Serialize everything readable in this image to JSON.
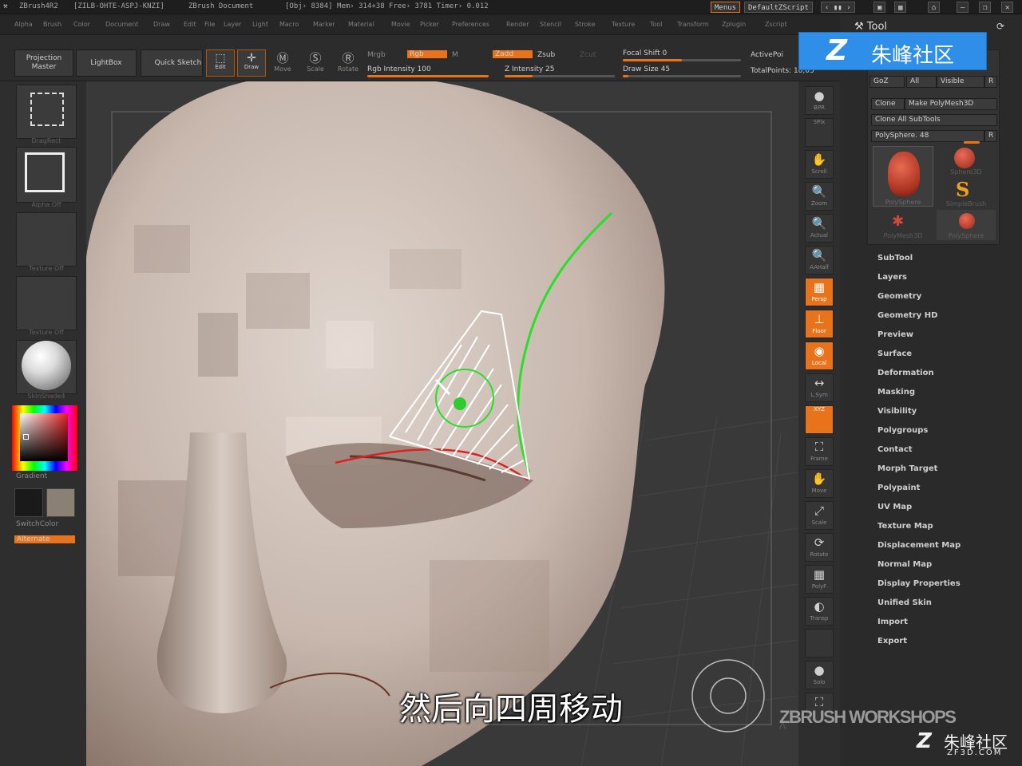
{
  "titlebar": {
    "app": "ZBrush4R2",
    "serial": "[ZILB-OHTE-ASPJ-KNZI]",
    "document": "ZBrush Document",
    "stats": "[Obj› 8384] Mem› 314+38 Free› 3781 Timer› 0.012",
    "menus": "Menus",
    "script": "DefaultZScript"
  },
  "menubar": [
    "Alpha",
    "Brush",
    "Color",
    "Document",
    "Draw",
    "Edit",
    "File",
    "Layer",
    "Light",
    "Macro",
    "Marker",
    "Material",
    "Movie",
    "Picker",
    "Preferences",
    "Render",
    "Stencil",
    "Stroke",
    "Texture",
    "Tool",
    "Transform",
    "Zplugin",
    "Zscript"
  ],
  "toolbar": {
    "projection_master": "Projection Master",
    "lightbox": "LightBox",
    "quick_sketch": "Quick Sketch",
    "edit": "Edit",
    "draw": "Draw",
    "move": "Move",
    "scale": "Scale",
    "rotate": "Rotate",
    "mrgb": "Mrgb",
    "rgb": "Rgb",
    "m": "M",
    "rgb_intensity": "Rgb Intensity 100",
    "zadd": "Zadd",
    "zsub": "Zsub",
    "zcut": "Zcut",
    "z_intensity": "Z Intensity 25",
    "focal_shift": "Focal Shift 0",
    "draw_size": "Draw Size 45",
    "active_points": "ActivePoi",
    "total_points": "TotalPoints: 10,05",
    "rgb_intensity_value": 100,
    "z_intensity_value": 25,
    "focal_shift_value": 0,
    "draw_size_value": 45
  },
  "left_shelf": {
    "stroke_caption": "DragRect",
    "alpha_caption": "Alpha Off",
    "texture_caption": "Texture Off",
    "texture2_caption": "Texture Off",
    "material_caption": "SkinShade4",
    "gradient": "Gradient",
    "switchcolor": "SwitchColor",
    "alternate": "Alternate",
    "main_color": "#1a1a1a",
    "secondary_color": "#8a8074"
  },
  "right_shelf": [
    {
      "name": "bpr",
      "label": "BPR",
      "glyph": "●",
      "on": false
    },
    {
      "name": "spix",
      "label": "SPix",
      "glyph": "",
      "on": false
    },
    {
      "name": "scroll",
      "label": "Scroll",
      "glyph": "✋",
      "on": false
    },
    {
      "name": "zoom",
      "label": "Zoom",
      "glyph": "🔍",
      "on": false
    },
    {
      "name": "actual",
      "label": "Actual",
      "glyph": "🔍",
      "on": false
    },
    {
      "name": "aahalf",
      "label": "AAHalf",
      "glyph": "🔍",
      "on": false
    },
    {
      "name": "persp",
      "label": "Persp",
      "glyph": "▦",
      "on": true
    },
    {
      "name": "floor",
      "label": "Floor",
      "glyph": "⊥",
      "on": true
    },
    {
      "name": "local",
      "label": "Local",
      "glyph": "◉",
      "on": true
    },
    {
      "name": "lsym",
      "label": "L.Sym",
      "glyph": "↔",
      "on": false
    },
    {
      "name": "xyz",
      "label": "XYZ",
      "glyph": "",
      "on": true
    },
    {
      "name": "frame",
      "label": "Frame",
      "glyph": "⛶",
      "on": false
    },
    {
      "name": "move",
      "label": "Move",
      "glyph": "✋",
      "on": false
    },
    {
      "name": "scale",
      "label": "Scale",
      "glyph": "⤢",
      "on": false
    },
    {
      "name": "rotate",
      "label": "Rotate",
      "glyph": "⟳",
      "on": false
    },
    {
      "name": "polyf",
      "label": "PolyF",
      "glyph": "▦",
      "on": false
    },
    {
      "name": "transp",
      "label": "Transp",
      "glyph": "◐",
      "on": false
    },
    {
      "name": "ghost",
      "label": "",
      "glyph": "",
      "on": false
    },
    {
      "name": "solo",
      "label": "Solo",
      "glyph": "●",
      "on": false
    },
    {
      "name": "xpose",
      "label": "",
      "glyph": "⛶",
      "on": false
    }
  ],
  "tray": {
    "tool_title": "Tool",
    "goz": "GoZ",
    "all": "All",
    "visible": "Visible",
    "r": "R",
    "clone": "Clone",
    "make_polymesh": "Make PolyMesh3D",
    "clone_all": "Clone All SubTools",
    "current_tool": "PolySphere. 48",
    "tools": [
      {
        "label": "PolySphere",
        "kind": "head"
      },
      {
        "label": "Sphere3D",
        "kind": "sphere"
      },
      {
        "label": "SimpleBrush",
        "kind": "brush"
      },
      {
        "label": "PolyMesh3D",
        "kind": "star"
      },
      {
        "label": "PolySphere",
        "kind": "sphere2"
      }
    ],
    "menu": [
      "SubTool",
      "Layers",
      "Geometry",
      "Geometry HD",
      "Preview",
      "Surface",
      "Deformation",
      "Masking",
      "Visibility",
      "Polygroups",
      "Contact",
      "Morph Target",
      "Polypaint",
      "UV Map",
      "Texture Map",
      "Displacement Map",
      "Normal Map",
      "Display Properties",
      "Unified Skin",
      "Import",
      "Export"
    ]
  },
  "watermark": {
    "logo_top": "朱峰社区",
    "workshops": "ZBRUSH WORKSHOPS",
    "logo_bottom": "朱峰社区",
    "site": "ZF3D.COM"
  },
  "subtitle": "然后向四周移动"
}
